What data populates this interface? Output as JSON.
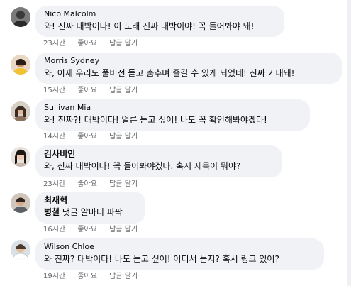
{
  "comments": [
    {
      "author": "Nico Malcolm",
      "text": "와! 진짜 대박이다! 이 노래 진짜 대박이야! 꼭 들어봐야 돼!",
      "time": "23시간",
      "like_label": "좋아요",
      "reply_label": "답글 달기"
    },
    {
      "author": "Morris Sydney",
      "text": "와, 이제 우리도 풀버전 듣고 춤추며 즐길 수 있게 되었네! 진짜 기대돼!",
      "time": "15시간",
      "like_label": "좋아요",
      "reply_label": "답글 달기"
    },
    {
      "author": "Sullivan Mia",
      "text": "와! 진짜?! 대박이다! 얼른 듣고 싶어! 나도 꼭 확인해봐야겠다!",
      "time": "14시간",
      "like_label": "좋아요",
      "reply_label": "답글 달기"
    },
    {
      "author": "김사비인",
      "text": "와, 진짜 대박이다! 꼭 들어봐야겠다. 혹시 제목이 뭐야?",
      "time": "23시간",
      "like_label": "좋아요",
      "reply_label": "답글 달기"
    },
    {
      "author": "최재혁",
      "text_highlight": "병철",
      "text_rest": " 댓글 알바티 파팍",
      "time": "16시간",
      "like_label": "좋아요",
      "reply_label": "답글 달기"
    },
    {
      "author": "Wilson Chloe",
      "text": "와 진짜? 대박이다! 나도 듣고 싶어! 어디서 듣지? 혹시 링크 있어?",
      "time": "19시간",
      "like_label": "좋아요",
      "reply_label": "답글 달기"
    }
  ]
}
